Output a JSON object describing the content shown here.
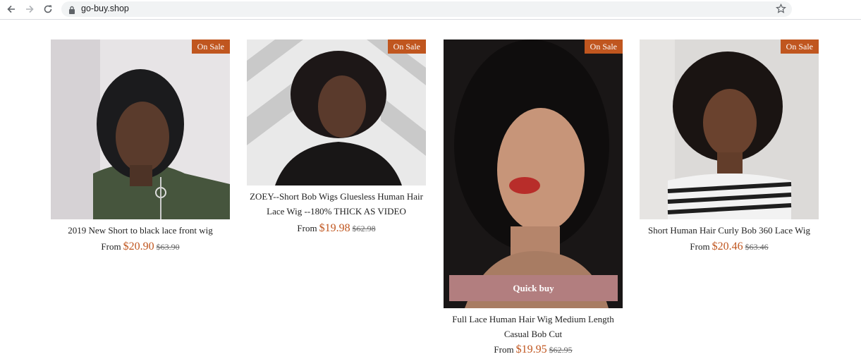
{
  "browser": {
    "url": "go-buy.shop",
    "icons": [
      "back-arrow-icon",
      "forward-arrow-icon",
      "reload-icon",
      "lock-icon",
      "star-icon"
    ]
  },
  "products": [
    {
      "badge": "On Sale",
      "title": "2019 New Short to black lace front wig",
      "from_label": "From",
      "price": "$20.90",
      "compare_price": "$63.90"
    },
    {
      "badge": "On Sale",
      "title": "ZOEY--Short Bob Wigs Gluesless Human Hair Lace Wig --180% THICK AS VIDEO",
      "from_label": "From",
      "price": "$19.98",
      "compare_price": "$62.98"
    },
    {
      "badge": "On Sale",
      "title": "Full Lace Human Hair Wig Medium Length Casual Bob Cut",
      "from_label": "From",
      "price": "$19.95",
      "compare_price": "$62.95",
      "quick_buy": "Quick buy"
    },
    {
      "badge": "On Sale",
      "title": "Short Human Hair Curly Bob 360 Lace Wig",
      "from_label": "From",
      "price": "$20.46",
      "compare_price": "$63.46"
    }
  ],
  "colors": {
    "badge": "#c0561f",
    "price": "#c0561f",
    "quick_buy": "#b27e7f"
  }
}
